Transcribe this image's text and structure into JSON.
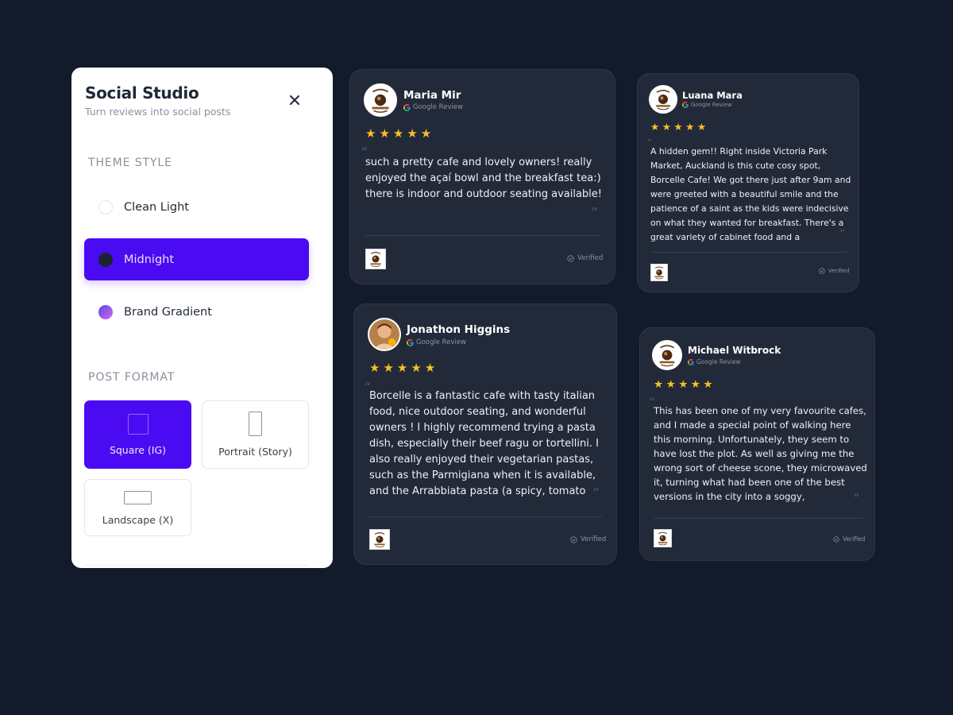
{
  "panel": {
    "title": "Social Studio",
    "subtitle": "Turn reviews into social posts",
    "close_icon": "close-icon",
    "theme_section": "THEME STYLE",
    "themes": [
      {
        "label": "Clean Light",
        "active": false
      },
      {
        "label": "Midnight",
        "active": true
      },
      {
        "label": "Brand Gradient",
        "active": false
      }
    ],
    "format_section": "POST FORMAT",
    "formats": [
      {
        "label": "Square (IG)",
        "icon": "square-icon",
        "active": true
      },
      {
        "label": "Portrait (Story)",
        "icon": "portrait-icon",
        "active": false
      },
      {
        "label": "Landscape (X)",
        "icon": "landscape-icon",
        "active": false
      }
    ]
  },
  "reviews": [
    {
      "name": "Maria Mir",
      "source": "Google Review",
      "stars": "★★★★★",
      "text": "such a pretty cafe and lovely owners! really enjoyed the açaí bowl and the breakfast tea:) there is indoor and outdoor seating available!",
      "verified": "Verified",
      "avatar": "cafe-logo"
    },
    {
      "name": "Luana Mara",
      "source": "Google Review",
      "stars": "★★★★★",
      "text": "A hidden gem!! Right inside Victoria Park Market, Auckland is this cute cosy spot, Borcelle Cafe! We got there just after 9am and were greeted with a beautiful smile and the patience of a saint as the kids were indecisive on what they wanted for breakfast. There's a great variety of cabinet food and a",
      "verified": "Verified",
      "avatar": "cafe-logo"
    },
    {
      "name": "Jonathon Higgins",
      "source": "Google Review",
      "stars": "★★★★★",
      "text": "Borcelle is a fantastic cafe with tasty italian food, nice outdoor seating, and wonderful owners ! I highly recommend trying a pasta dish, especially their beef ragu or tortellini. I also really enjoyed their vegetarian pastas, such as the Parmigiana when it is available, and the Arrabbiata pasta (a spicy, tomato",
      "verified": "Verified",
      "avatar": "person-photo"
    },
    {
      "name": "Michael Witbrock",
      "source": "Google Review",
      "stars": "★★★★★",
      "text": "This has been one of my very favourite cafes, and I made a special point of walking here this morning. Unfortunately, they seem to have lost the plot. As well as giving me the wrong sort of cheese scone, they microwaved it, turning what had been one of the best versions in the city into a soggy,",
      "verified": "Verified",
      "avatar": "cafe-logo"
    }
  ],
  "colors": {
    "page_bg": "#131a29",
    "card_bg": "#222a3a",
    "accent": "#4a0bf2",
    "star": "#fbbf24"
  }
}
